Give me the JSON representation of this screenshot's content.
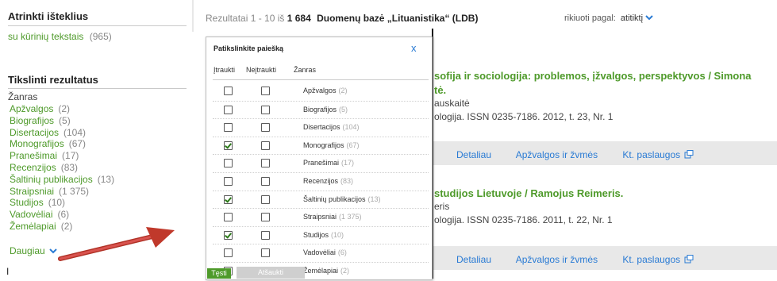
{
  "sidebar": {
    "resources_title": "Atrinkti išteklius",
    "resource_item": {
      "label": "su kūrinių tekstais",
      "count": "(965)"
    },
    "refine_title": "Tikslinti rezultatus",
    "facet_heading": "Žanras",
    "facets": [
      {
        "label": "Apžvalgos",
        "count": "(2)"
      },
      {
        "label": "Biografijos",
        "count": "(5)"
      },
      {
        "label": "Disertacijos",
        "count": "(104)"
      },
      {
        "label": "Monografijos",
        "count": "(67)"
      },
      {
        "label": "Pranešimai",
        "count": "(17)"
      },
      {
        "label": "Recenzijos",
        "count": "(83)"
      },
      {
        "label": "Šaltinių publikacijos",
        "count": "(13)"
      },
      {
        "label": "Straipsniai",
        "count": "(1 375)"
      },
      {
        "label": "Studijos",
        "count": "(10)"
      },
      {
        "label": "Vadovėliai",
        "count": "(6)"
      },
      {
        "label": "Žemėlapiai",
        "count": "(2)"
      }
    ],
    "more_label": "Daugiau",
    "cursor_glyph": "I"
  },
  "header": {
    "results_prefix": "Rezultatai 1 - 10 iš",
    "results_total": "1 684",
    "database": "Duomenų bazė „Lituanistika“ (LDB)",
    "sort_label": "rikiuoti pagal:",
    "sort_value": "atitiktį"
  },
  "results": [
    {
      "title": "sofija ir sociologija: problemos, įžvalgos, perspektyvos / Simona",
      "title2": "tė.",
      "author": "auskaitė",
      "source": "ologija. ISSN 0235-7186. 2012, t. 23, Nr. 1",
      "links": [
        "Detaliau",
        "Apžvalgos ir žvmės",
        "Kt. paslaugos"
      ]
    },
    {
      "title": "studijos Lietuvoje / Ramojus Reimeris.",
      "author": "eris",
      "source": "ologija. ISSN 0235-7186. 2011, t. 22, Nr. 1",
      "links": [
        "Detaliau",
        "Apžvalgos ir žvmės",
        "Kt. paslaugos"
      ]
    }
  ],
  "popup": {
    "title": "Patikslinkite paiešką",
    "close": "x",
    "col_include": "Įtraukti",
    "col_exclude": "Neįtraukti",
    "col_genre": "Žanras",
    "rows": [
      {
        "label": "Apžvalgos",
        "count": "(2)",
        "include": false,
        "exclude": false
      },
      {
        "label": "Biografijos",
        "count": "(5)",
        "include": false,
        "exclude": false
      },
      {
        "label": "Disertacijos",
        "count": "(104)",
        "include": false,
        "exclude": false
      },
      {
        "label": "Monografijos",
        "count": "(67)",
        "include": true,
        "exclude": false
      },
      {
        "label": "Pranešimai",
        "count": "(17)",
        "include": false,
        "exclude": false
      },
      {
        "label": "Recenzijos",
        "count": "(83)",
        "include": false,
        "exclude": false
      },
      {
        "label": "Šaltinių publikacijos",
        "count": "(13)",
        "include": true,
        "exclude": false
      },
      {
        "label": "Straipsniai",
        "count": "(1 375)",
        "include": false,
        "exclude": false
      },
      {
        "label": "Studijos",
        "count": "(10)",
        "include": true,
        "exclude": false
      },
      {
        "label": "Vadovėliai",
        "count": "(6)",
        "include": false,
        "exclude": false
      },
      {
        "label": "Žemėlapiai",
        "count": "(2)",
        "include": false,
        "exclude": false
      }
    ],
    "continue_label": "Tęsti",
    "cancel_label": "Atšaukti"
  },
  "colors": {
    "accent_green": "#4e9a2a",
    "link_blue": "#2a7bd4",
    "arrow_red": "#c0392b"
  }
}
